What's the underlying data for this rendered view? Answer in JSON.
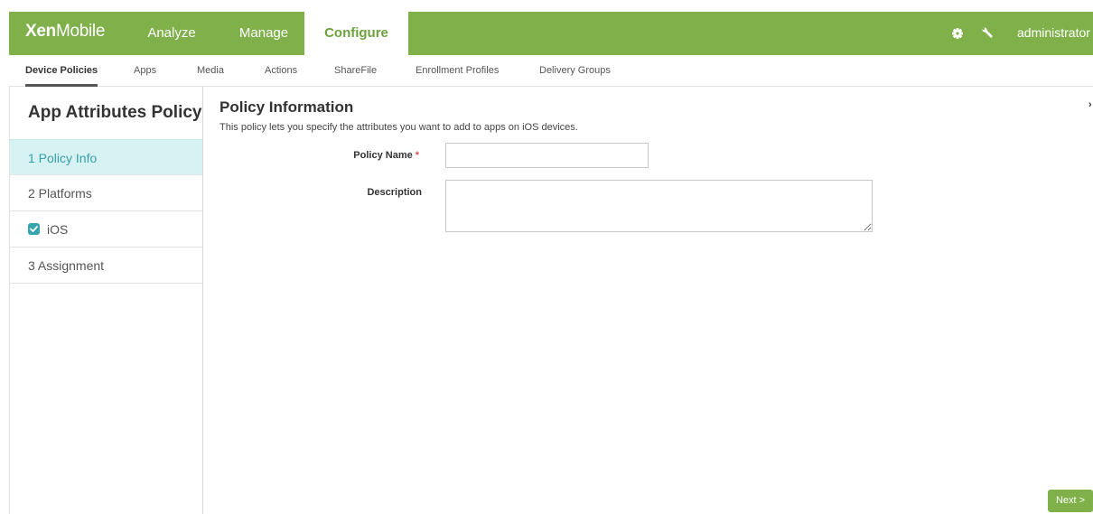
{
  "header": {
    "brand_bold": "Xen",
    "brand_light": "Mobile",
    "nav": [
      {
        "label": "Analyze",
        "active": false
      },
      {
        "label": "Manage",
        "active": false
      },
      {
        "label": "Configure",
        "active": true
      }
    ],
    "icons": [
      "gear-icon",
      "wrench-icon"
    ],
    "user": "administrator",
    "colors": {
      "bar": "#7fb04a",
      "active_text": "#6ea23c"
    }
  },
  "subtabs": [
    {
      "label": "Device Policies",
      "active": true
    },
    {
      "label": "Apps",
      "active": false
    },
    {
      "label": "Media",
      "active": false
    },
    {
      "label": "Actions",
      "active": false
    },
    {
      "label": "ShareFile",
      "active": false
    },
    {
      "label": "Enrollment Profiles",
      "active": false
    },
    {
      "label": "Delivery Groups",
      "active": false
    }
  ],
  "sidebar": {
    "title": "App Attributes Policy",
    "steps": [
      {
        "label": "1 Policy Info",
        "active": true
      },
      {
        "label": "2 Platforms",
        "active": false
      },
      {
        "label": "iOS",
        "checked": true
      },
      {
        "label": "3 Assignment",
        "active": false
      }
    ],
    "colors": {
      "active_bg": "#d6f2f3",
      "active_text": "#38a0a8",
      "checkbox": "#37a4ad"
    }
  },
  "main": {
    "title": "Policy Information",
    "description": "This policy lets you specify the attributes you want to add to apps on iOS devices.",
    "fields": {
      "policy_name_label": "Policy Name",
      "policy_name_required": "*",
      "policy_name_value": "",
      "description_label": "Description",
      "description_value": ""
    },
    "collapse_glyph": "›",
    "next_label": "Next >"
  }
}
